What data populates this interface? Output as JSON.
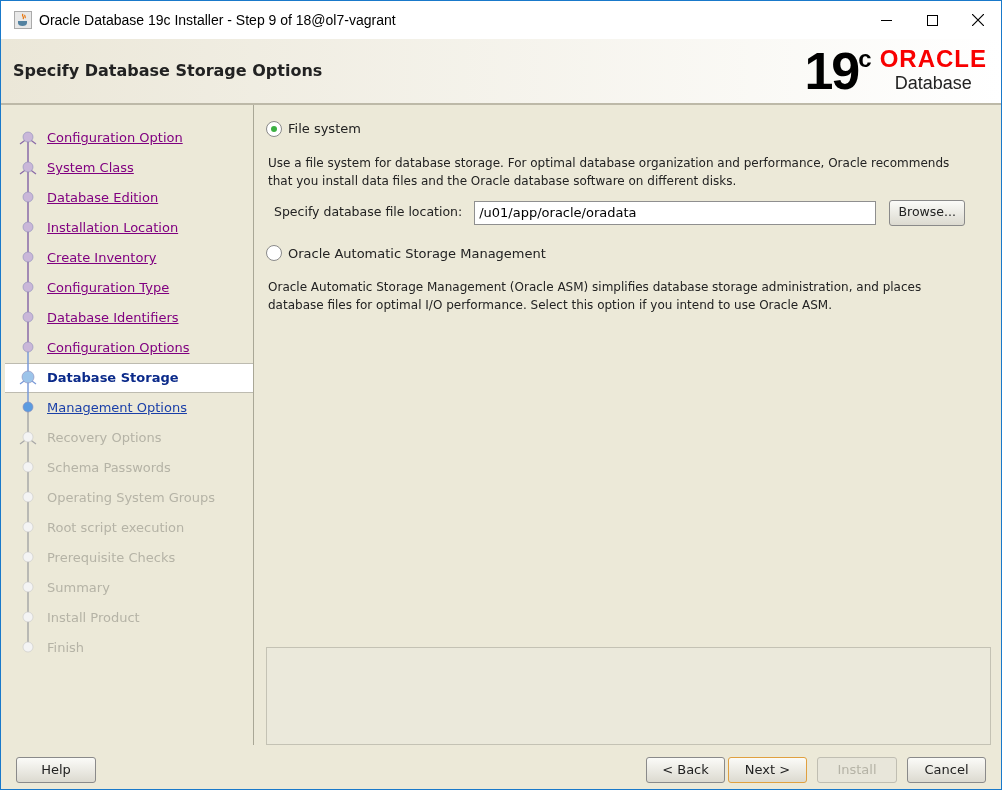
{
  "window": {
    "title": "Oracle Database 19c Installer - Step 9 of 18@ol7-vagrant"
  },
  "header": {
    "title": "Specify Database Storage Options",
    "logo": {
      "version": "19",
      "version_sup": "c",
      "brand": "ORACLE",
      "product": "Database"
    }
  },
  "steps": [
    {
      "label": "Configuration Option",
      "visited": true,
      "selected": false,
      "disabled": false,
      "kind": "branch"
    },
    {
      "label": "System Class",
      "visited": true,
      "selected": false,
      "disabled": false,
      "kind": "branch"
    },
    {
      "label": "Database Edition",
      "visited": true,
      "selected": false,
      "disabled": false,
      "kind": "step"
    },
    {
      "label": "Installation Location",
      "visited": true,
      "selected": false,
      "disabled": false,
      "kind": "step"
    },
    {
      "label": "Create Inventory",
      "visited": true,
      "selected": false,
      "disabled": false,
      "kind": "step"
    },
    {
      "label": "Configuration Type",
      "visited": true,
      "selected": false,
      "disabled": false,
      "kind": "step"
    },
    {
      "label": "Database Identifiers",
      "visited": true,
      "selected": false,
      "disabled": false,
      "kind": "step"
    },
    {
      "label": "Configuration Options",
      "visited": true,
      "selected": false,
      "disabled": false,
      "kind": "step"
    },
    {
      "label": "Database Storage",
      "visited": false,
      "selected": true,
      "disabled": false,
      "kind": "branch"
    },
    {
      "label": "Management Options",
      "visited": false,
      "selected": false,
      "disabled": false,
      "kind": "step"
    },
    {
      "label": "Recovery Options",
      "visited": false,
      "selected": false,
      "disabled": true,
      "kind": "branch"
    },
    {
      "label": "Schema Passwords",
      "visited": false,
      "selected": false,
      "disabled": true,
      "kind": "step"
    },
    {
      "label": "Operating System Groups",
      "visited": false,
      "selected": false,
      "disabled": true,
      "kind": "step"
    },
    {
      "label": "Root script execution",
      "visited": false,
      "selected": false,
      "disabled": true,
      "kind": "step"
    },
    {
      "label": "Prerequisite Checks",
      "visited": false,
      "selected": false,
      "disabled": true,
      "kind": "step"
    },
    {
      "label": "Summary",
      "visited": false,
      "selected": false,
      "disabled": true,
      "kind": "step"
    },
    {
      "label": "Install Product",
      "visited": false,
      "selected": false,
      "disabled": true,
      "kind": "step"
    },
    {
      "label": "Finish",
      "visited": false,
      "selected": false,
      "disabled": true,
      "kind": "step"
    }
  ],
  "options": [
    {
      "label": "File system",
      "selected": true,
      "description": "Use a file system for database storage. For optimal database organization and performance, Oracle recommends that you install data files and the Oracle database software on different disks.",
      "field": {
        "label": "Specify database file location:",
        "value": "/u01/app/oracle/oradata",
        "button": "Browse..."
      }
    },
    {
      "label": "Oracle Automatic Storage Management",
      "selected": false,
      "description": "Oracle Automatic Storage Management (Oracle ASM) simplifies database storage administration, and places database files for optimal I/O performance. Select this option if you intend to use Oracle ASM."
    }
  ],
  "buttons": {
    "help": {
      "label": "Help",
      "disabled": false
    },
    "back": {
      "label": "< Back",
      "disabled": false
    },
    "next": {
      "label": "Next >",
      "disabled": false
    },
    "install": {
      "label": "Install",
      "disabled": true
    },
    "cancel": {
      "label": "Cancel",
      "disabled": false
    }
  }
}
